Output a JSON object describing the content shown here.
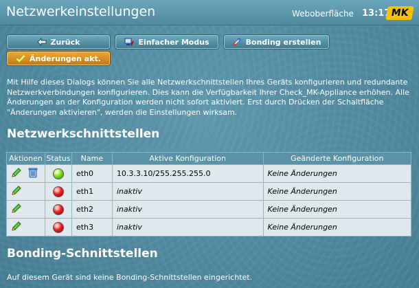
{
  "header": {
    "title": "Netzwerkeinstellungen",
    "web_ui_label": "Weboberfläche",
    "time": "13:17",
    "logo_text": "MK"
  },
  "toolbar": {
    "back_label": "Zurück",
    "simple_mode_label": "Einfacher Modus",
    "create_bonding_label": "Bonding erstellen",
    "activate_changes_label": "Änderungen akt."
  },
  "intro_text": "Mit Hilfe dieses Dialogs können Sie alle Netzwerkschnittstellen Ihres Geräts konfigurieren und redundante Netzwerkverbindungen konfigurieren. Dies kann die Verfügbarkeit Ihrer Check_MK-Appliance erhöhen. Alle Änderungen an der Konfiguration werden nicht sofort aktiviert. Erst durch Drücken der Schaltfläche \"Änderungen aktivieren\", werden die Einstellungen wirksam.",
  "interfaces_section": {
    "heading": "Netzwerkschnittstellen",
    "columns": [
      "Aktionen",
      "Status",
      "Name",
      "Aktive Konfiguration",
      "Geänderte Konfiguration"
    ],
    "rows": [
      {
        "name": "eth0",
        "status": "green",
        "active_config": "10.3.3.10/255.255.255.0",
        "changed_config": "Keine Änderungen",
        "has_delete": true
      },
      {
        "name": "eth1",
        "status": "red",
        "active_config": "inaktiv",
        "changed_config": "Keine Änderungen",
        "has_delete": false
      },
      {
        "name": "eth2",
        "status": "red",
        "active_config": "inaktiv",
        "changed_config": "Keine Änderungen",
        "has_delete": false
      },
      {
        "name": "eth3",
        "status": "red",
        "active_config": "inaktiv",
        "changed_config": "Keine Änderungen",
        "has_delete": false
      }
    ]
  },
  "bonding_section": {
    "heading": "Bonding-Schnittstellen",
    "empty_text": "Auf diesem Gerät sind keine Bonding-Schnittstellen eingerichtet."
  },
  "colors": {
    "accent_orange": "#d88b1f",
    "button_blue": "#4f8aa0",
    "status_green": "#7be31b",
    "status_red": "#f02020"
  }
}
